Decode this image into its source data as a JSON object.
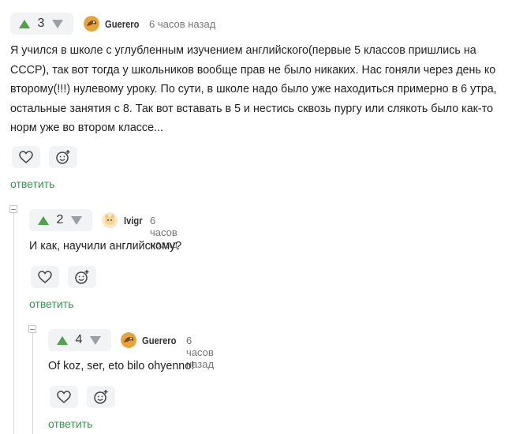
{
  "comments": [
    {
      "author": "Guerero",
      "time": "6 часов назад",
      "score": "3",
      "text": "Я учился в школе с углубленным изучением английского(первые 5 классов пришлись на СССР), так вот тогда у школьников вообще прав не было никаких. Нас гоняли через день ко второму(!!!) нулевому уроку. По сути, в школе надо было уже находиться примерно в 6 утра, остальные занятия с 8. Так вот вставать в 5 и нестись сквозь пургу или слякоть было как-то норм уже во втором классе...",
      "reply_label": "ответить",
      "avatar_icon": "bird-avatar-icon"
    },
    {
      "author": "Ivigr",
      "time": "6 часов назад",
      "score": "2",
      "text": "И как, научили английскому?",
      "reply_label": "ответить",
      "avatar_icon": "cat-avatar-icon"
    },
    {
      "author": "Guerero",
      "time": "6 часов назад",
      "score": "4",
      "text": "Of koz, ser, eto bilo ohyenno!",
      "reply_label": "ответить",
      "avatar_icon": "bird-avatar-icon"
    }
  ],
  "colors": {
    "upvote": "#4fa14a",
    "downvote": "#9aa0a6",
    "reply": "#2e9a4a",
    "button_bg": "#f2f3f5"
  }
}
